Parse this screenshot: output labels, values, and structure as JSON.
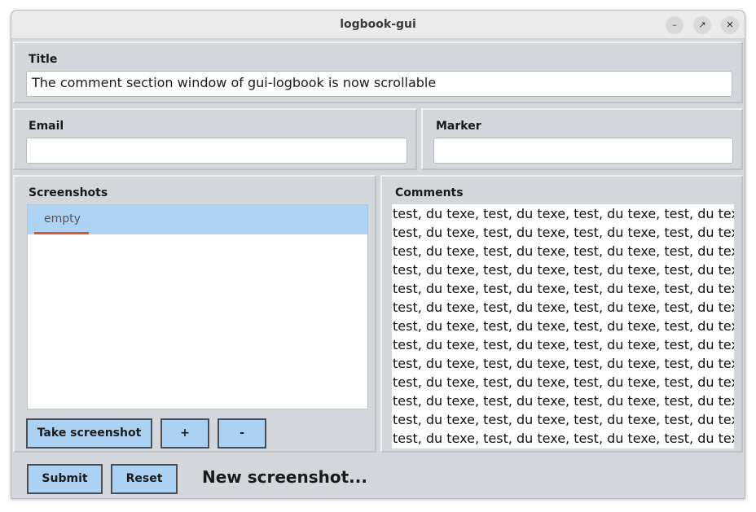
{
  "window": {
    "title": "logbook-gui"
  },
  "title_panel": {
    "label": "Title",
    "value": "The comment section window of gui-logbook is now scrollable"
  },
  "email_panel": {
    "label": "Email",
    "value": ""
  },
  "marker_panel": {
    "label": "Marker",
    "value": ""
  },
  "screenshots_panel": {
    "label": "Screenshots",
    "items": [
      "empty"
    ],
    "take_label": "Take screenshot",
    "add_label": "+",
    "remove_label": "-"
  },
  "comments_panel": {
    "label": "Comments",
    "lines": [
      "test, du texe, test, du texe, test, du texe, test, du texe,",
      "test, du texe, test, du texe, test, du texe, test, du texe,",
      "test, du texe, test, du texe, test, du texe, test, du texe,",
      "test, du texe, test, du texe, test, du texe, test, du texe,",
      "test, du texe, test, du texe, test, du texe, test, du texe,",
      "test, du texe, test, du texe, test, du texe, test, du texe,",
      "test, du texe, test, du texe, test, du texe, test, du texe,",
      "test, du texe, test, du texe, test, du texe, test, du texe,",
      "test, du texe, test, du texe, test, du texe, test, du texe,",
      "test, du texe, test, du texe, test, du texe, test, du texe,",
      "test, du texe, test, du texe, test, du texe, test, du texe,",
      "test, du texe, test, du texe, test, du texe, test, du texe,",
      "test, du texe, test, du texe, test, du texe, test, du texe,"
    ]
  },
  "bottom": {
    "submit_label": "Submit",
    "reset_label": "Reset",
    "status": "New screenshot..."
  },
  "colors": {
    "accent": "#abd1f3",
    "selection": "#aed3f5",
    "focus_underline": "#e0532c"
  }
}
